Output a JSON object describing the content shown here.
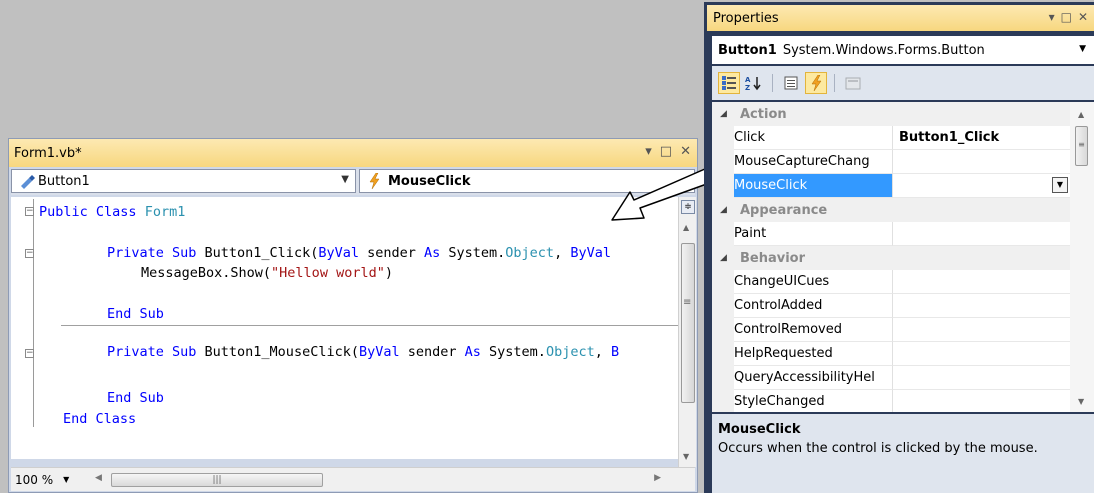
{
  "editor": {
    "title": "Form1.vb*",
    "window_buttons": [
      "▾",
      "□",
      "✕"
    ],
    "class_combo": "Button1",
    "method_combo": "MouseClick",
    "zoom": "100 %",
    "code": {
      "line1_kw": "Public Class",
      "line1_name": "Form1",
      "line2_a": "Private Sub",
      "line2_b": " Button1_Click(",
      "line2_c": "ByVal",
      "line2_d": " sender ",
      "line2_e": "As",
      "line2_f": " System.",
      "line2_g": "Object",
      "line2_h": ", ",
      "line2_i": "ByVal",
      "line3_a": "MessageBox.Show(",
      "line3_b": "\"Hellow world\"",
      "line3_c": ")",
      "line4": "End Sub",
      "line5_a": "Private Sub",
      "line5_b": " Button1_MouseClick(",
      "line5_c": "ByVal",
      "line5_d": " sender ",
      "line5_e": "As",
      "line5_f": " System.",
      "line5_g": "Object",
      "line5_h": ", ",
      "line5_i": "B",
      "line6": "End Sub",
      "line7": "End Class"
    }
  },
  "properties": {
    "title": "Properties",
    "window_buttons": [
      "▾",
      "□",
      "✕"
    ],
    "object_name": "Button1",
    "object_type": "System.Windows.Forms.Button",
    "rows": {
      "cat_action": "Action",
      "click_name": "Click",
      "click_value": "Button1_Click",
      "mousecapture": "MouseCaptureChang",
      "mouseclick": "MouseClick",
      "cat_appearance": "Appearance",
      "paint": "Paint",
      "cat_behavior": "Behavior",
      "changeuicues": "ChangeUICues",
      "controladded": "ControlAdded",
      "controlremoved": "ControlRemoved",
      "helprequested": "HelpRequested",
      "queryaccess": "QueryAccessibilityHel",
      "stylechanged": "StyleChanged"
    },
    "description_title": "MouseClick",
    "description_text": "Occurs when the control is clicked by the mouse."
  },
  "icons": {
    "categorized": "categorized-icon",
    "alphabetical": "alphabetical-icon",
    "properties": "properties-icon",
    "events": "events-lightning-icon",
    "property_pages": "property-pages-icon"
  }
}
